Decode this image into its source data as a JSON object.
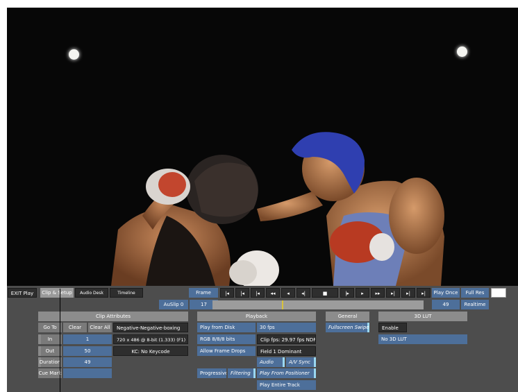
{
  "topbar": {
    "exit": "EXIT Play",
    "tabs": [
      "Clip & Setup",
      "Audio Desk",
      "Timeline"
    ],
    "frame_label": "Frame",
    "transport_glyphs": [
      "|◄",
      "|◄",
      "|◄",
      "◄◄",
      "◄",
      "◄|",
      "■",
      "|►",
      "►",
      "►►",
      "►|",
      "►|"
    ],
    "play_once": "Play Once",
    "full_res": "Full Res",
    "auslip": "AuSlip 0",
    "frame_value": "17",
    "end_value": "49",
    "realtime": "Realtime"
  },
  "clip_attributes": {
    "header": "Clip Attributes",
    "goto": "Go To",
    "clear": "Clear",
    "clear_all": "Clear All",
    "clip_name": "Negative-Negative-boxing",
    "resolution": "720 x 486 @ 8-bit (1.333) (F1)",
    "keycode": "KC: No Keycode",
    "in_label": "In",
    "in_value": "1",
    "out_label": "Out",
    "out_value": "50",
    "duration_label": "Duration",
    "duration_value": "49",
    "cue_mark": "Cue Mark",
    "cue_value": ""
  },
  "playback": {
    "header": "Playback",
    "play_from_disk": "Play from Disk",
    "fps": "30 fps",
    "rgb": "RGB 8/8/8 bits",
    "clip_fps": "Clip fps: 29.97 fps NDF",
    "allow_frame_drops": "Allow Frame Drops",
    "field": "Field 1 Dominant",
    "audio": "Audio",
    "av_sync": "A/V Sync",
    "progressive": "Progressive",
    "filtering": "Filtering",
    "play_from_positioner": "Play From Positioner",
    "play_entire_track": "Play Entire Track"
  },
  "general": {
    "header": "General",
    "fullscreen_swipe": "Fullscreen Swipe"
  },
  "lut": {
    "header": "3D LUT",
    "enable": "Enable",
    "no_lut": "No 3D LUT"
  },
  "colors": {
    "panel": "#4d4d4d",
    "button_blue": "#4d6f9a",
    "active_bar": "#9ad7f0",
    "header_gray": "#8c8c8c"
  }
}
